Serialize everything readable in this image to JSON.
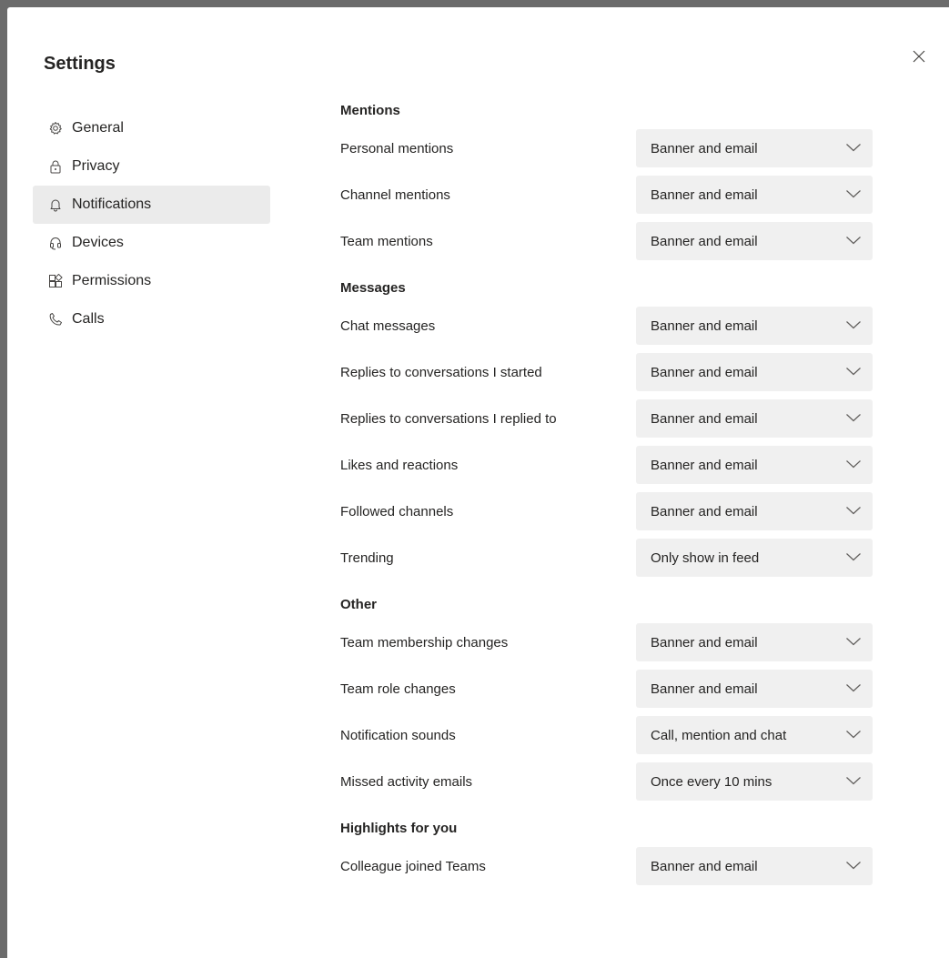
{
  "dialog": {
    "title": "Settings"
  },
  "nav": {
    "items": [
      {
        "label": "General",
        "icon": "gear-icon",
        "active": false
      },
      {
        "label": "Privacy",
        "icon": "lock-icon",
        "active": false
      },
      {
        "label": "Notifications",
        "icon": "bell-icon",
        "active": true
      },
      {
        "label": "Devices",
        "icon": "headset-icon",
        "active": false
      },
      {
        "label": "Permissions",
        "icon": "apps-icon",
        "active": false
      },
      {
        "label": "Calls",
        "icon": "phone-icon",
        "active": false
      }
    ]
  },
  "sections": [
    {
      "title": "Mentions",
      "rows": [
        {
          "label": "Personal mentions",
          "value": "Banner and email"
        },
        {
          "label": "Channel mentions",
          "value": "Banner and email"
        },
        {
          "label": "Team mentions",
          "value": "Banner and email"
        }
      ]
    },
    {
      "title": "Messages",
      "rows": [
        {
          "label": "Chat messages",
          "value": "Banner and email"
        },
        {
          "label": "Replies to conversations I started",
          "value": "Banner and email"
        },
        {
          "label": "Replies to conversations I replied to",
          "value": "Banner and email"
        },
        {
          "label": "Likes and reactions",
          "value": "Banner and email"
        },
        {
          "label": "Followed channels",
          "value": "Banner and email"
        },
        {
          "label": "Trending",
          "value": "Only show in feed"
        }
      ]
    },
    {
      "title": "Other",
      "rows": [
        {
          "label": "Team membership changes",
          "value": "Banner and email"
        },
        {
          "label": "Team role changes",
          "value": "Banner and email"
        },
        {
          "label": "Notification sounds",
          "value": "Call, mention and chat"
        },
        {
          "label": "Missed activity emails",
          "value": "Once every 10 mins"
        }
      ]
    },
    {
      "title": "Highlights for you",
      "rows": [
        {
          "label": "Colleague joined Teams",
          "value": "Banner and email"
        }
      ]
    }
  ]
}
